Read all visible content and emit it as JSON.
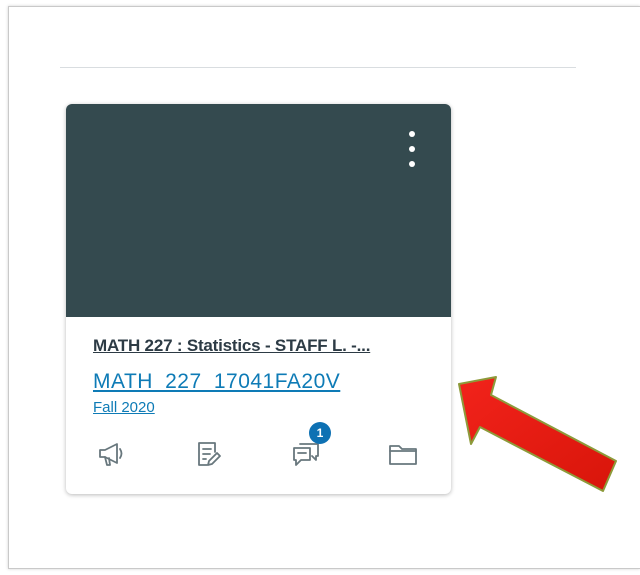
{
  "dashboard": {
    "card": {
      "hero_color": "#344a4f",
      "title": "MATH 227 : Statistics - STAFF L. -...",
      "code": "MATH_227_17041FA20V",
      "term": "Fall 2020",
      "menu_icon": "kebab-icon",
      "actions": [
        {
          "icon": "announcements-icon"
        },
        {
          "icon": "assignments-icon"
        },
        {
          "icon": "discussions-icon",
          "badge": "1"
        },
        {
          "icon": "files-icon"
        }
      ]
    }
  },
  "annotation": {
    "icon": "red-arrow-icon",
    "color": "#e8150b"
  }
}
